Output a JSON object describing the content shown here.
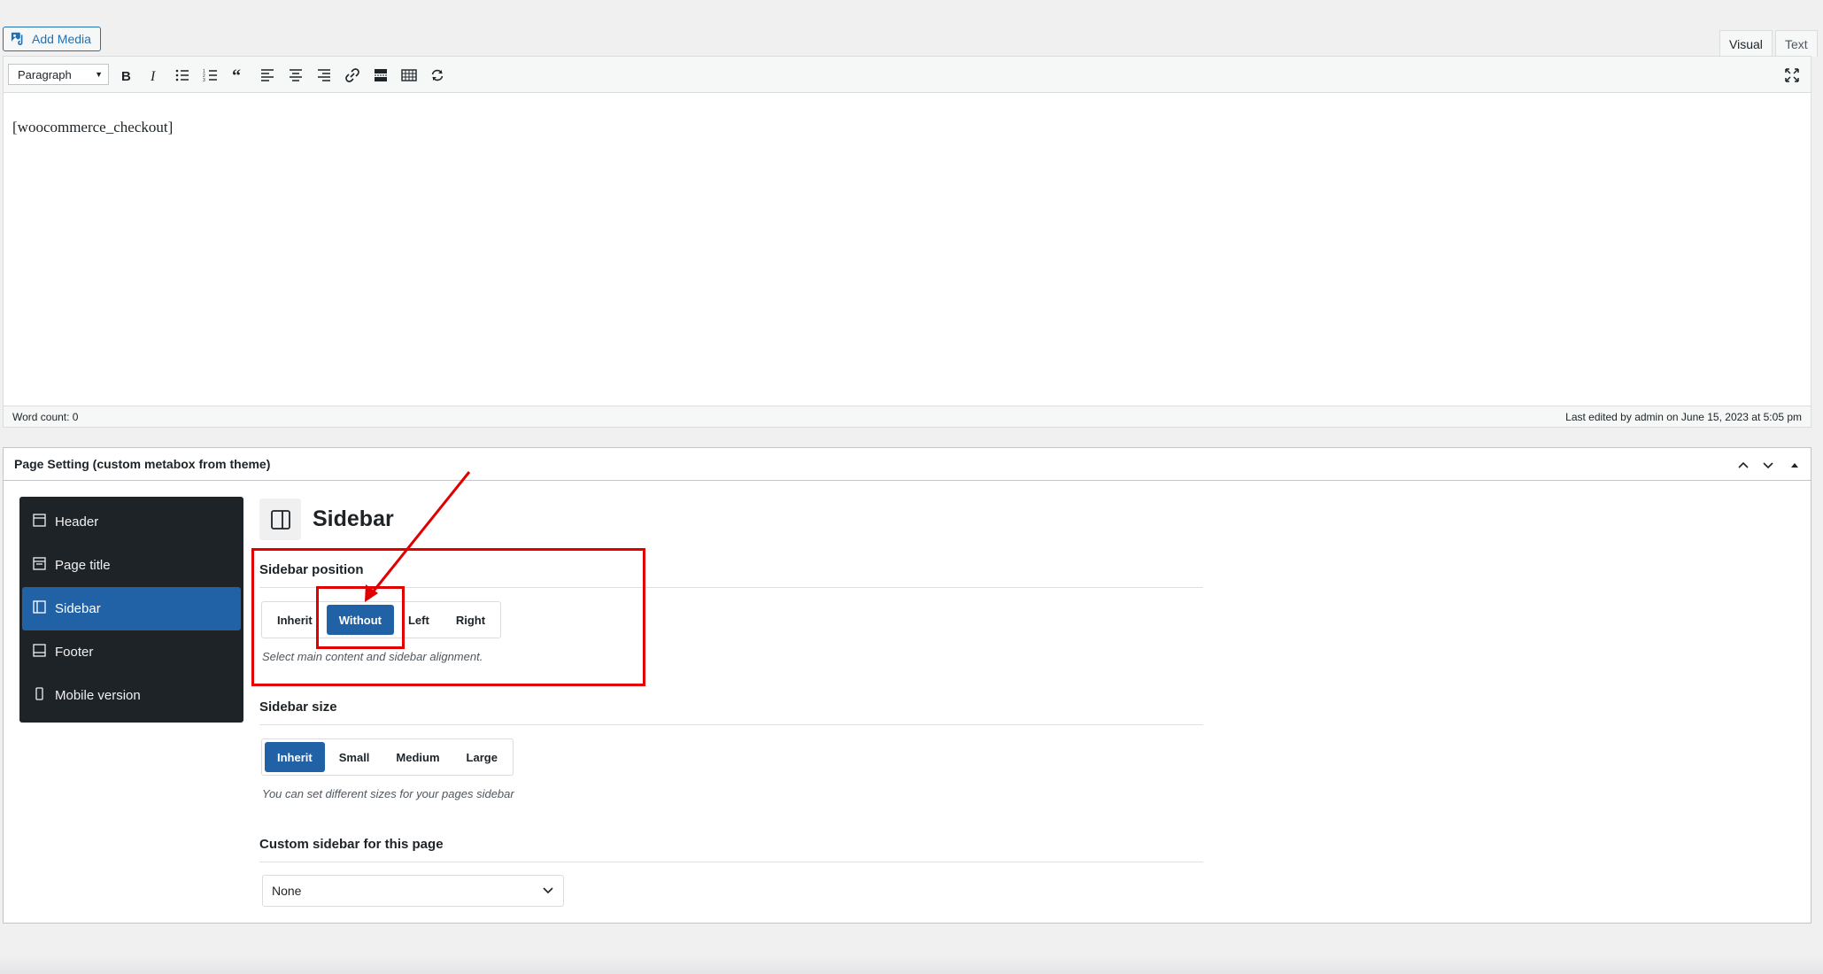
{
  "top": {
    "add_media_label": "Add Media",
    "tabs": [
      "Visual",
      "Text"
    ]
  },
  "editor": {
    "format_select": "Paragraph",
    "toolbar_icons": [
      "bold-icon",
      "italic-icon",
      "bulleted-list-icon",
      "numbered-list-icon",
      "blockquote-icon",
      "align-left-icon",
      "align-center-icon",
      "align-right-icon",
      "link-icon",
      "read-more-icon",
      "toolbar-toggle-icon",
      "refresh-icon"
    ],
    "content": "[woocommerce_checkout]",
    "word_count": "Word count: 0",
    "last_edited": "Last edited by admin on June 15, 2023 at 5:05 pm"
  },
  "metabox": {
    "title": "Page Setting (custom metabox from theme)",
    "nav": [
      {
        "label": "Header",
        "icon": "header-icon"
      },
      {
        "label": "Page title",
        "icon": "page-title-icon"
      },
      {
        "label": "Sidebar",
        "icon": "sidebar-icon"
      },
      {
        "label": "Footer",
        "icon": "footer-icon"
      },
      {
        "label": "Mobile version",
        "icon": "mobile-icon"
      }
    ],
    "section_title": "Sidebar",
    "sidebar_position": {
      "label": "Sidebar position",
      "options": [
        "Inherit",
        "Without",
        "Left",
        "Right"
      ],
      "selected": "Without",
      "help": "Select main content and sidebar alignment."
    },
    "sidebar_size": {
      "label": "Sidebar size",
      "options": [
        "Inherit",
        "Small",
        "Medium",
        "Large"
      ],
      "selected": "Inherit",
      "help": "You can set different sizes for your pages sidebar"
    },
    "custom_sidebar": {
      "label": "Custom sidebar for this page",
      "value": "None"
    }
  },
  "colors": {
    "accent": "#2161a6",
    "annotation": "#e00000",
    "nav_bg": "#1d2327"
  }
}
